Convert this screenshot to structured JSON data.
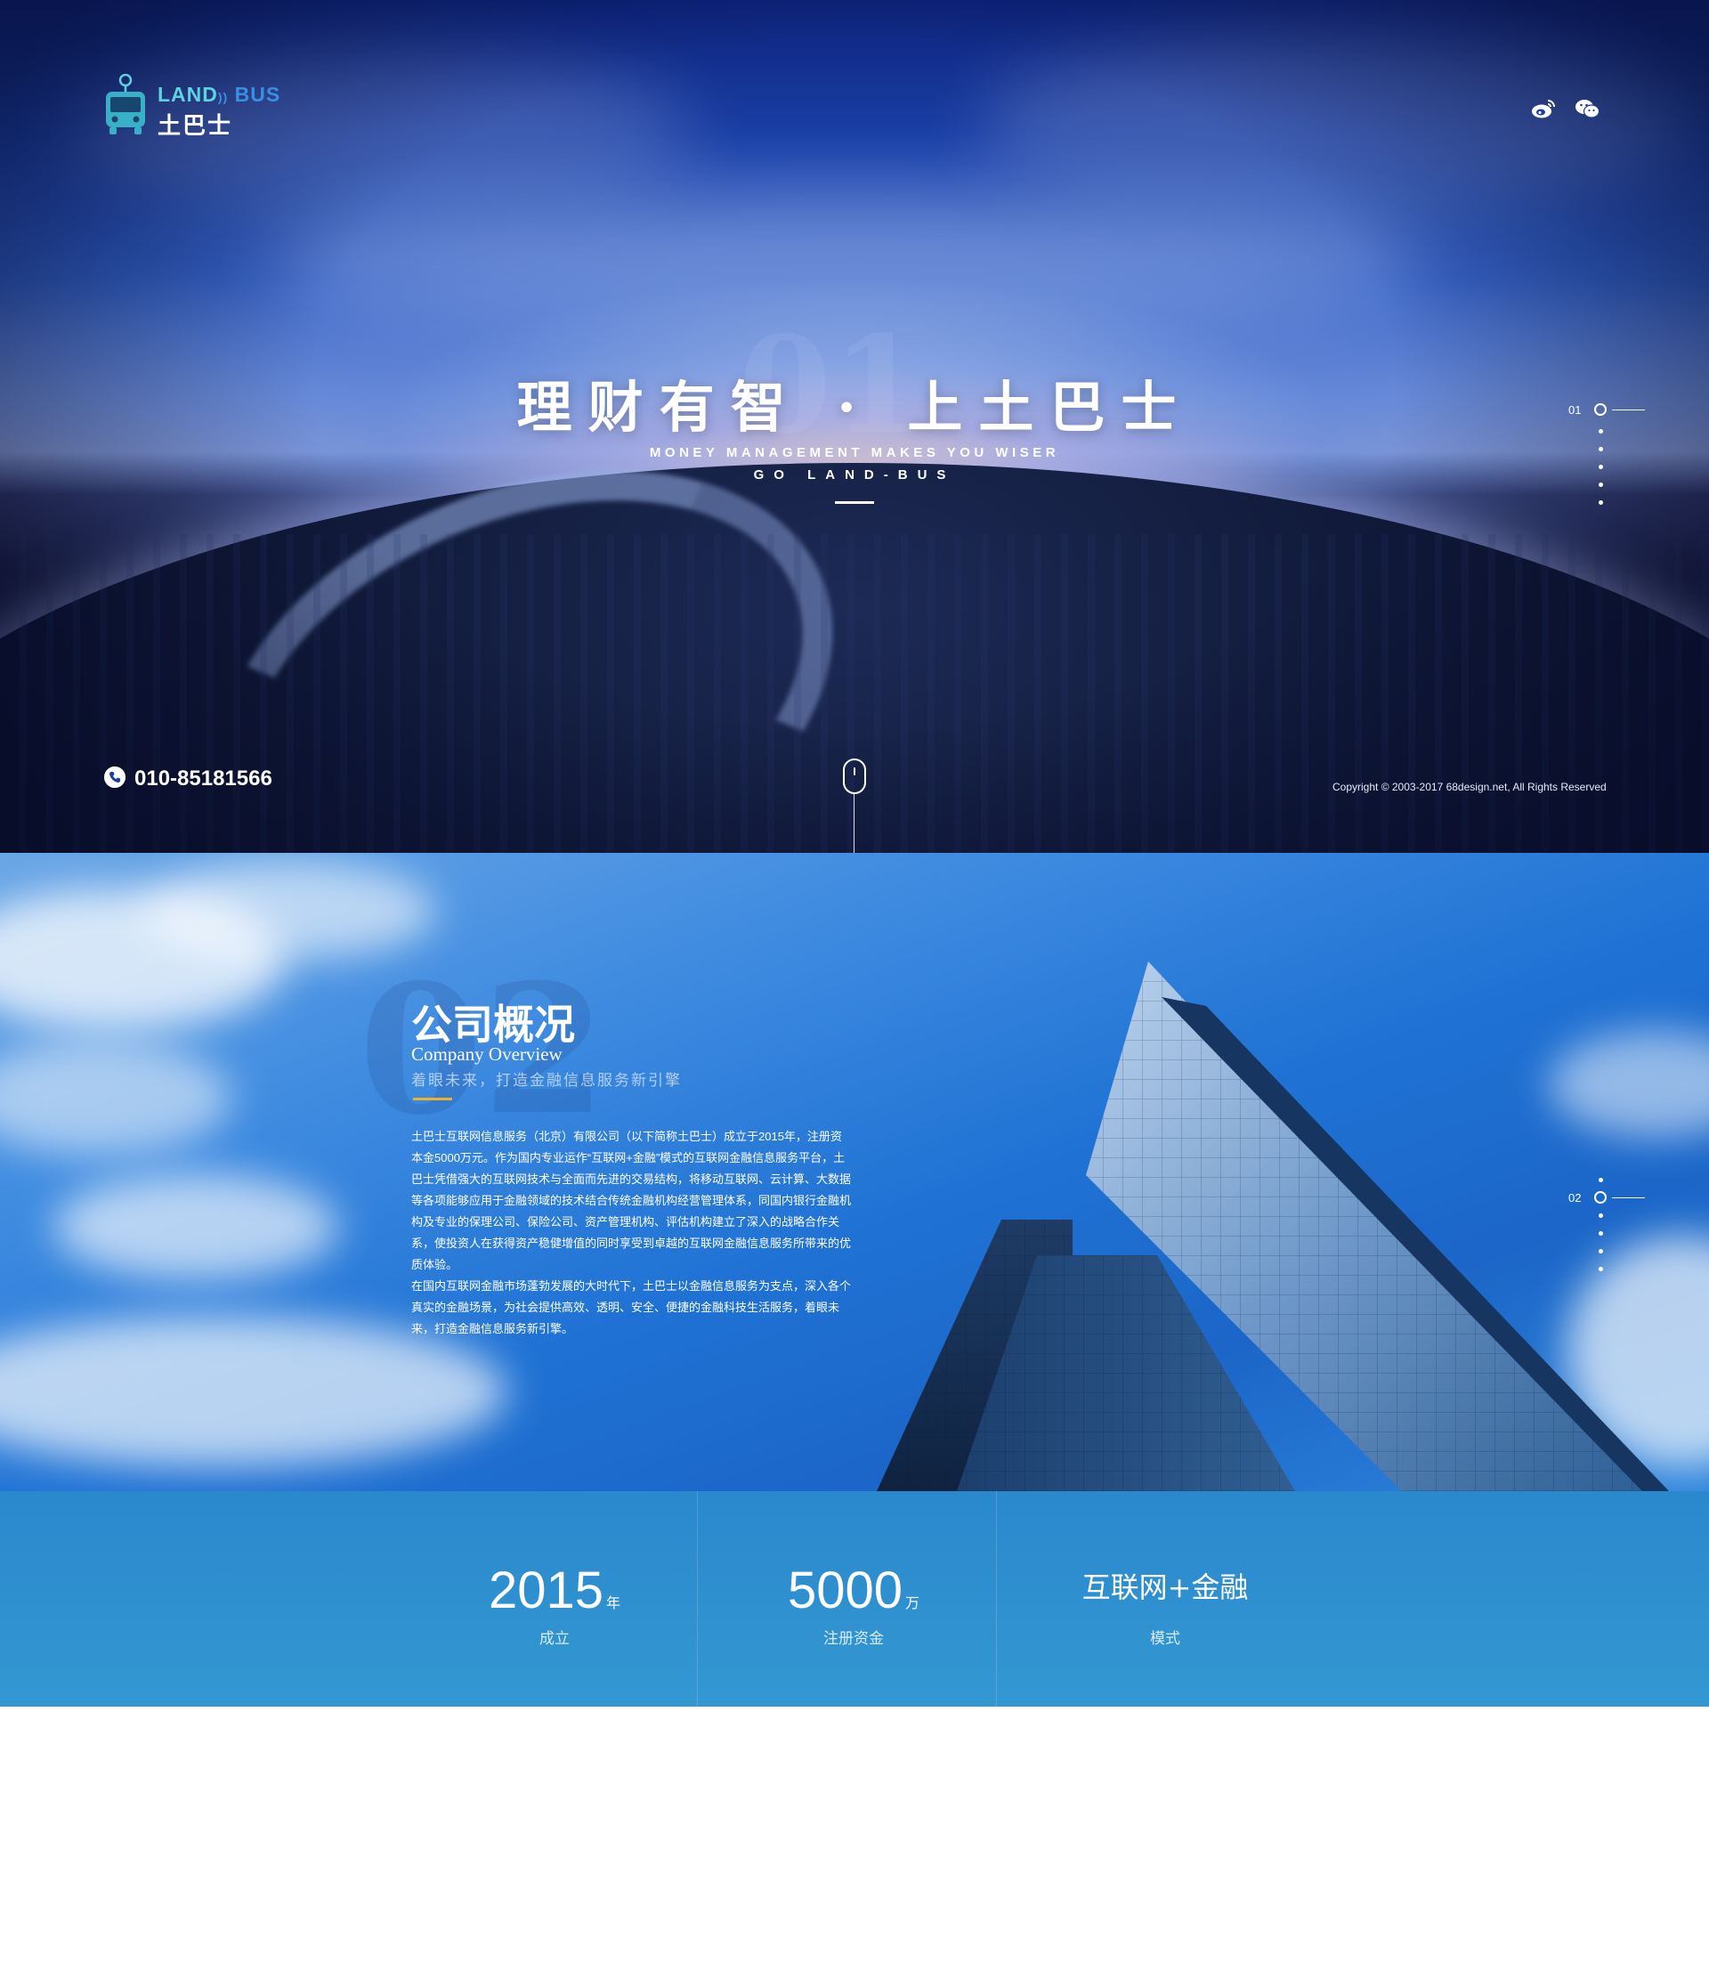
{
  "hero": {
    "logo": {
      "en_prefix": "LAND",
      "en_suffix": "BUS",
      "cn": "土巴士"
    },
    "social": [
      "weibo-icon",
      "wechat-icon"
    ],
    "background_number": "01",
    "title": "理财有智 · 上土巴士",
    "subtitle_1": "MONEY MANAGEMENT MAKES YOU WISER",
    "subtitle_2": "GO LAND-BUS",
    "phone": "010-85181566",
    "copyright": "Copyright © 2003-2017 68design.net, All Rights Reserved",
    "nav_number": "01"
  },
  "about": {
    "background_number": "02",
    "title": "公司概况",
    "title_en": "Company Overview",
    "slogan": "着眼未来，打造金融信息服务新引擎",
    "paragraph_1": "土巴士互联网信息服务（北京）有限公司（以下简称土巴士）成立于2015年，注册资本金5000万元。作为国内专业运作“互联网+金融”模式的互联网金融信息服务平台，土巴士凭借强大的互联网技术与全面而先进的交易结构，将移动互联网、云计算、大数据等各项能够应用于金融领域的技术结合传统金融机构经营管理体系，同国内银行金融机构及专业的保理公司、保险公司、资产管理机构、评估机构建立了深入的战略合作关系，使投资人在获得资产稳健增值的同时享受到卓越的互联网金融信息服务所带来的优质体验。",
    "paragraph_2": "在国内互联网金融市场蓬勃发展的大时代下，土巴士以金融信息服务为支点，深入各个真实的金融场景，为社会提供高效、透明、安全、便捷的金融科技生活服务，着眼未来，打造金融信息服务新引擎。",
    "nav_number": "02"
  },
  "stats": [
    {
      "value": "2015",
      "unit": "年",
      "label": "成立"
    },
    {
      "value": "5000",
      "unit": "万",
      "label": "注册资金"
    },
    {
      "value": "互联网+金融",
      "label": "模式"
    }
  ],
  "colors": {
    "accent_gold": "#f2b026",
    "stats_band": "#2e8fcf",
    "logo_teal": "#5fd2e2"
  }
}
